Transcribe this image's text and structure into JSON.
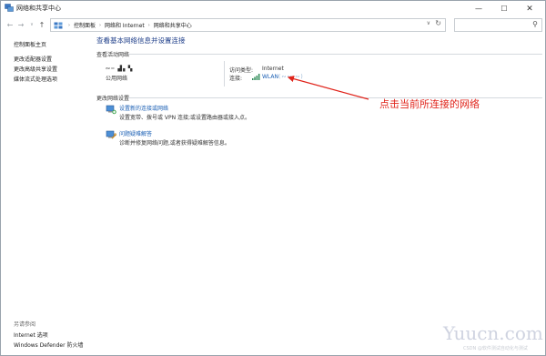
{
  "window": {
    "title": "网络和共享中心"
  },
  "nav": {
    "address": [
      "控制面板",
      "网络和 Internet",
      "网络和共享中心"
    ]
  },
  "left": {
    "links": [
      "控制面板主页",
      "更改适配器设置",
      "更改高级共享设置",
      "媒体流式处理选项"
    ],
    "see_also_title": "另请参阅",
    "see_also_links": [
      "Internet 选项",
      "Windows Defender 防火墙"
    ]
  },
  "main": {
    "title": "查看基本网络信息并设置连接",
    "active_networks_label": "查看活动网络",
    "network_name": "∾┉ ▟▖▚",
    "network_category": "公用网络",
    "access_type_label": "访问类型:",
    "access_type_value": "Internet",
    "connections_label": "连接:",
    "connection_name": "WLAN",
    "connection_extra": "(∾∾ ∾)",
    "change_settings_label": "更改网络设置",
    "tasks": [
      {
        "title": "设置新的连接或网络",
        "desc": "设置宽带、拨号或 VPN 连接;或设置路由器或接入点。",
        "icon": "network-setup-icon"
      },
      {
        "title": "问题疑难解答",
        "desc": "诊断并修复网络问题,或者获得疑难解答信息。",
        "icon": "troubleshoot-icon"
      }
    ]
  },
  "annotation": {
    "text": "点击当前所连接的网络",
    "color": "#e0241b"
  },
  "watermark": {
    "text": "Yuucn.com",
    "subtext": "CSDN @软件测试自动化与测试"
  },
  "colors": {
    "link": "#1a5fb4",
    "title": "#1f3f8a"
  }
}
